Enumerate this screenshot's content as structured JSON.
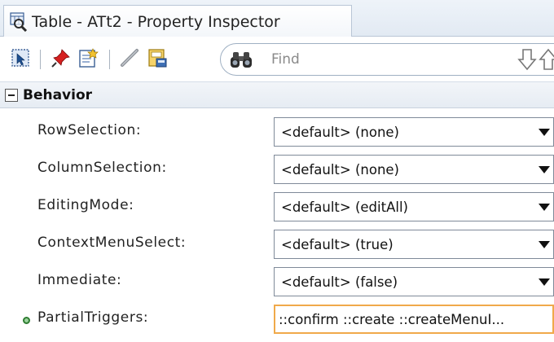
{
  "tab": {
    "title": "Table - ATt2 - Property Inspector",
    "icon": "property-inspector-icon"
  },
  "toolbar": {
    "buttons": [
      {
        "icon": "select-icon"
      },
      {
        "icon": "pin-icon"
      },
      {
        "icon": "edit-properties-icon"
      },
      {
        "icon": "pencil-icon"
      },
      {
        "icon": "bind-icon"
      }
    ],
    "find": {
      "icon": "binoculars-icon",
      "placeholder": "Find"
    },
    "nav": [
      "arrow-down-icon",
      "arrow-up-icon"
    ]
  },
  "section": {
    "title": "Behavior",
    "expanded": true
  },
  "properties": [
    {
      "label": "RowSelection:",
      "value": "<default> (none)",
      "type": "select"
    },
    {
      "label": "ColumnSelection:",
      "value": "<default> (none)",
      "type": "select"
    },
    {
      "label": "EditingMode:",
      "value": "<default> (editAll)",
      "type": "select"
    },
    {
      "label": "ContextMenuSelect:",
      "value": "<default> (true)",
      "type": "select"
    },
    {
      "label": "Immediate:",
      "value": "<default> (false)",
      "type": "select"
    },
    {
      "label": "PartialTriggers:",
      "value": "::confirm ::create ::createMenuI...",
      "type": "text",
      "modified": true
    }
  ],
  "colors": {
    "accent_border": "#f0a94a",
    "modified_dot": "#2f7d32"
  }
}
